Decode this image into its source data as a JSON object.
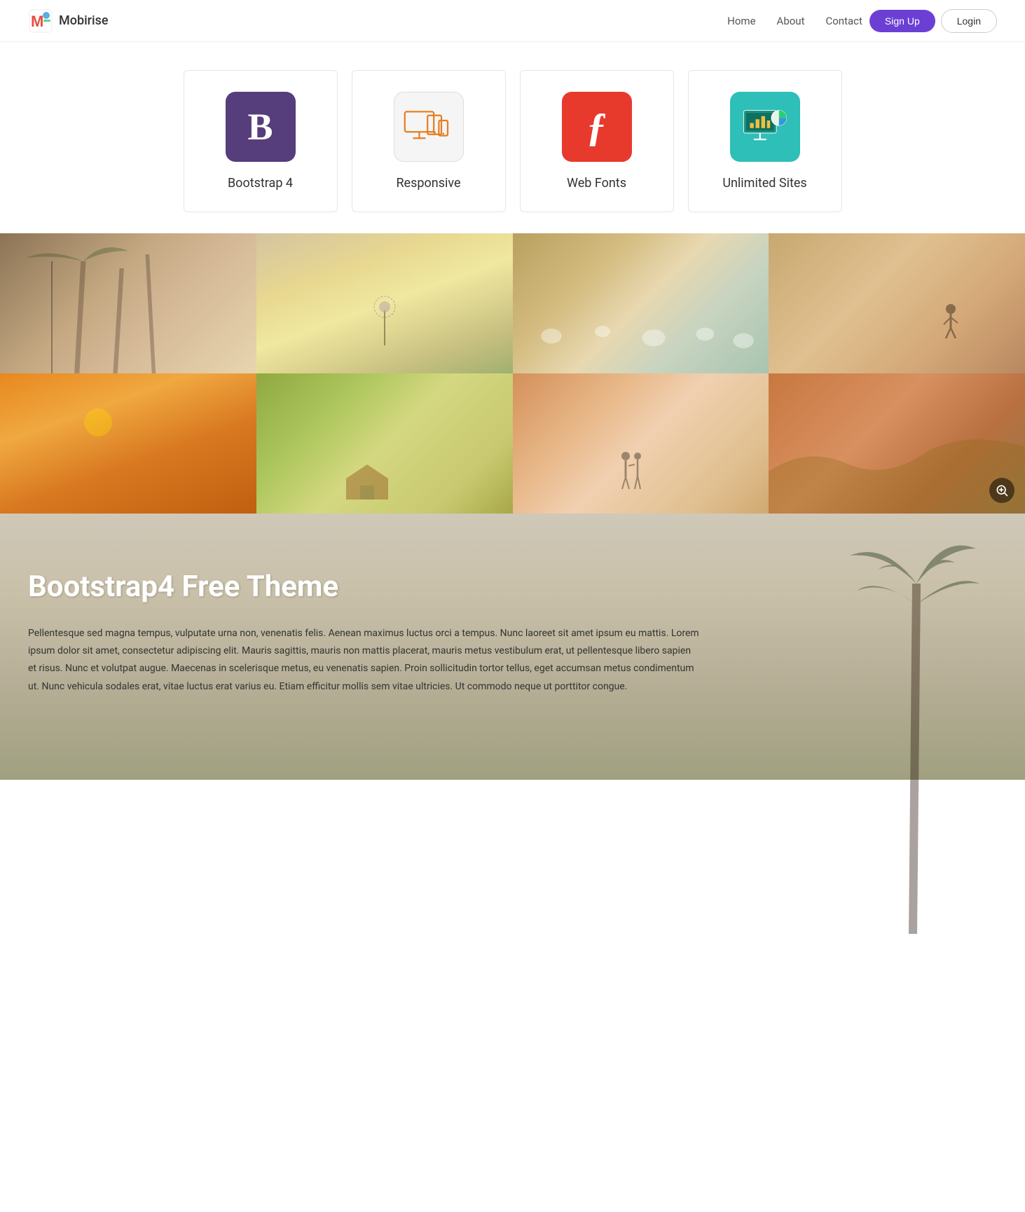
{
  "navbar": {
    "brand_name": "Mobirise",
    "nav_items": [
      {
        "label": "Home",
        "href": "#"
      },
      {
        "label": "About",
        "href": "#"
      },
      {
        "label": "Contact",
        "href": "#"
      }
    ],
    "signup_label": "Sign Up",
    "login_label": "Login"
  },
  "features": {
    "cards": [
      {
        "id": "bootstrap",
        "label": "Bootstrap 4",
        "icon_type": "bootstrap",
        "icon_text": "B"
      },
      {
        "id": "responsive",
        "label": "Responsive",
        "icon_type": "responsive",
        "icon_text": ""
      },
      {
        "id": "webfonts",
        "label": "Web Fonts",
        "icon_type": "webfonts",
        "icon_text": "ƒ"
      },
      {
        "id": "unlimited",
        "label": "Unlimited Sites",
        "icon_type": "unlimited",
        "icon_text": ""
      }
    ]
  },
  "gallery": {
    "photos": [
      {
        "id": 1,
        "alt": "Palm trees beach"
      },
      {
        "id": 2,
        "alt": "Dandelion flower"
      },
      {
        "id": 3,
        "alt": "White flowers field"
      },
      {
        "id": 4,
        "alt": "Person on hillside"
      },
      {
        "id": 5,
        "alt": "Sunset landscape"
      },
      {
        "id": 6,
        "alt": "Barn in field"
      },
      {
        "id": 7,
        "alt": "Couple at sunset"
      },
      {
        "id": 8,
        "alt": "Rocky cliffs"
      }
    ]
  },
  "content": {
    "heading": "Bootstrap4 Free Theme",
    "body": "Pellentesque sed magna tempus, vulputate urna non, venenatis felis. Aenean maximus luctus orci a tempus. Nunc laoreet sit amet ipsum eu mattis. Lorem ipsum dolor sit amet, consectetur adipiscing elit. Mauris sagittis, mauris non mattis placerat, mauris metus vestibulum erat, ut pellentesque libero sapien et risus. Nunc et volutpat augue. Maecenas in scelerisque metus, eu venenatis sapien. Proin sollicitudin tortor tellus, eget accumsan metus condimentum ut. Nunc vehicula sodales erat, vitae luctus erat varius eu. Etiam efficitur mollis sem vitae ultricies. Ut commodo neque ut porttitor congue."
  }
}
